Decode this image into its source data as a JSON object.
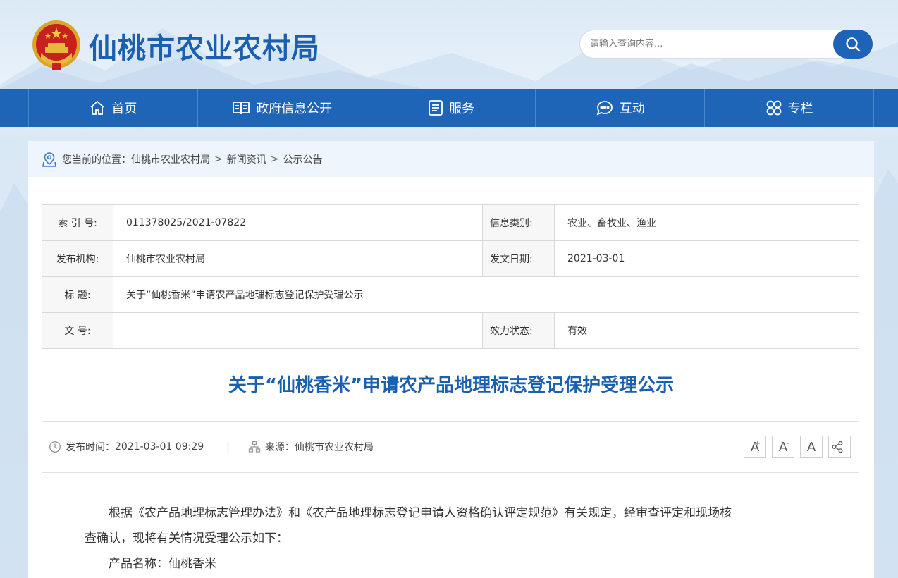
{
  "header": {
    "site_title": "仙桃市农业农村局",
    "search_placeholder": "请输入查询内容..."
  },
  "nav": {
    "items": [
      {
        "label": "首页",
        "icon": "home-icon"
      },
      {
        "label": "政府信息公开",
        "icon": "book-icon"
      },
      {
        "label": "服务",
        "icon": "list-icon"
      },
      {
        "label": "互动",
        "icon": "chat-icon"
      },
      {
        "label": "专栏",
        "icon": "grid-icon"
      }
    ]
  },
  "breadcrumb": {
    "prefix": "您当前的位置：",
    "items": [
      "仙桃市农业农村局",
      "新闻资讯",
      "公示公告"
    ],
    "separator": ">"
  },
  "info_table": {
    "index_label": "索 引 号:",
    "index_value": "011378025/2021-07822",
    "category_label": "信息类别:",
    "category_value": "农业、畜牧业、渔业",
    "publisher_label": "发布机构:",
    "publisher_value": "仙桃市农业农村局",
    "date_label": "发文日期:",
    "date_value": "2021-03-01",
    "title_label": "标 题:",
    "title_value": "关于“仙桃香米”申请农产品地理标志登记保护受理公示",
    "doc_no_label": "文 号:",
    "doc_no_value": "",
    "status_label": "效力状态:",
    "status_value": "有效"
  },
  "article": {
    "title": "关于“仙桃香米”申请农产品地理标志登记保护受理公示",
    "publish_time_label": "发布时间：",
    "publish_time": "2021-03-01 09:29",
    "divider": "|",
    "source_label": "来源：",
    "source": "仙桃市农业农村局",
    "tools": {
      "font_increase": "A",
      "font_decrease": "A",
      "font_reset": "A",
      "share_icon": "share-icon"
    },
    "paragraph1_line1": "根据《农产品地理标志管理办法》和《农产品地理标志登记申请人资格确认评定规范》有关规定，经审查评定和现场核",
    "paragraph1_line2": "查确认，现将有关情况受理公示如下：",
    "paragraph2": "产品名称：仙桃香米"
  },
  "colors": {
    "brand_blue": "#1f65b7",
    "title_blue": "#1a5fb0"
  }
}
